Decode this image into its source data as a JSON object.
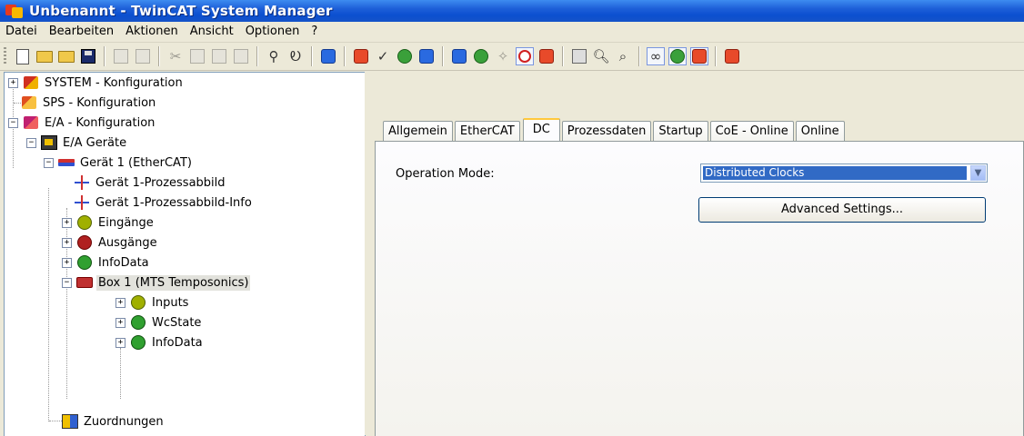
{
  "window": {
    "title": "Unbenannt - TwinCAT System Manager"
  },
  "menu": {
    "items": [
      "Datei",
      "Bearbeiten",
      "Aktionen",
      "Ansicht",
      "Optionen",
      "?"
    ]
  },
  "toolbar": {
    "icons": [
      "new-icon",
      "open-icon",
      "open-remote-icon",
      "save-icon",
      "print-icon",
      "print-preview-icon",
      "cut-icon",
      "copy-icon",
      "paste-icon",
      "paste-special-icon",
      "find-icon",
      "find-next-icon",
      "edit-icon",
      "activate-config-icon",
      "check-icon",
      "build-icon",
      "restart-icon",
      "config-mode-icon",
      "scan-icon",
      "free-run-icon",
      "target-icon",
      "toggle-icon",
      "list-view-icon",
      "zoom-icon",
      "show-online-icon",
      "watch-icon",
      "locate-icon",
      "online-watch-icon",
      "more-icon"
    ]
  },
  "tree": {
    "items": [
      {
        "label": "SYSTEM - Konfiguration",
        "expander": "+"
      },
      {
        "label": "SPS - Konfiguration",
        "expander": ""
      },
      {
        "label": "E/A - Konfiguration",
        "expander": "−"
      },
      {
        "label": "E/A Geräte",
        "expander": "−"
      },
      {
        "label": "Gerät 1 (EtherCAT)",
        "expander": "−"
      },
      {
        "label": "Gerät 1-Prozessabbild",
        "expander": ""
      },
      {
        "label": "Gerät 1-Prozessabbild-Info",
        "expander": ""
      },
      {
        "label": "Eingänge",
        "expander": "+"
      },
      {
        "label": "Ausgänge",
        "expander": "+"
      },
      {
        "label": "InfoData",
        "expander": "+"
      },
      {
        "label": "Box 1 (MTS Temposonics)",
        "expander": "−"
      },
      {
        "label": "Inputs",
        "expander": "+"
      },
      {
        "label": "WcState",
        "expander": "+"
      },
      {
        "label": "InfoData",
        "expander": "+"
      },
      {
        "label": "Zuordnungen",
        "expander": ""
      }
    ]
  },
  "tabs": [
    "Allgemein",
    "EtherCAT",
    "DC",
    "Prozessdaten",
    "Startup",
    "CoE - Online",
    "Online"
  ],
  "dc": {
    "operation_mode_label": "Operation Mode:",
    "operation_mode_value": "Distributed Clocks",
    "advanced_button": "Advanced Settings..."
  }
}
